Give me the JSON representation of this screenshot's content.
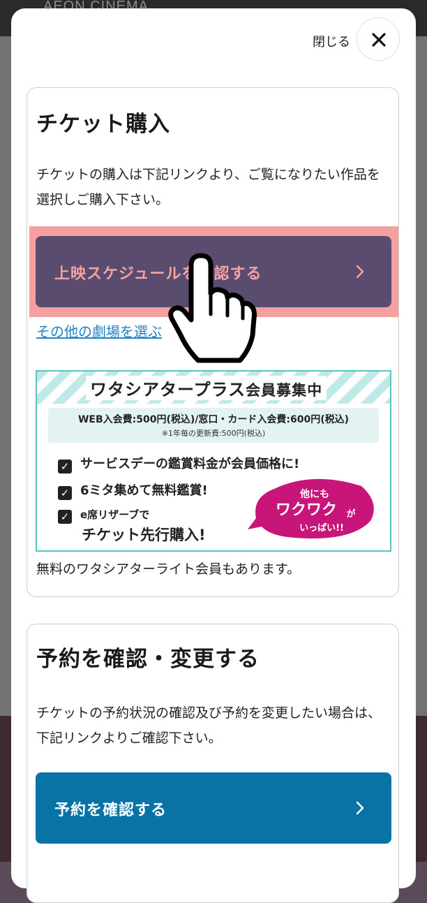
{
  "background": {
    "logo": "AEON CINEMA"
  },
  "modal": {
    "close_label": "閉じる"
  },
  "ticket": {
    "title": "チケット購入",
    "desc": "チケットの購入は下記リンクより、ご覧になりたい作品を選択しご購入下さい。",
    "schedule_button": "上映スケジュールを確認する",
    "other_theater_link": "その他の劇場を選ぶ",
    "lite_note": "無料のワタシアターライト会員もあります。"
  },
  "banner": {
    "title_main": "ワタシアタープラス",
    "title_sub": "会員募集中",
    "fee_line": "WEB入会費:500円(税込)/窓口・カード入会費:600円(税込)",
    "renew_line": "※1年毎の更新費:500円(税込)",
    "benefits": [
      "サービスデーの鑑賞料金が会員価格に!",
      "6ミタ集めて無料鑑賞!",
      "e席リザーブで",
      "チケット先行購入!"
    ],
    "bubble_lines": [
      "他にも",
      "ワクワク",
      "が",
      "いっぱい!!"
    ]
  },
  "reserve": {
    "title": "予約を確認・変更する",
    "desc": "チケットの予約状況の確認及び予約を変更したい場合は、下記リンクよりご確認下さい。",
    "button": "予約を確認する"
  },
  "colors": {
    "schedule_button_bg": "#5a4c6e",
    "schedule_button_text": "#f4a2a2",
    "reserve_button_bg": "#0a73a6",
    "highlight": "#f4a0a0",
    "link": "#2283c5"
  }
}
